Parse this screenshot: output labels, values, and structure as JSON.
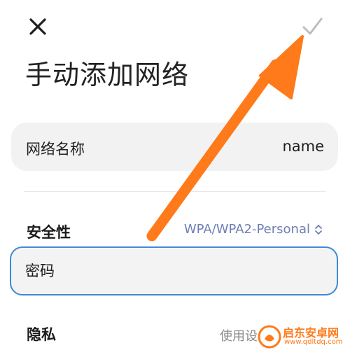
{
  "header": {
    "close_icon": "close-icon",
    "confirm_icon": "checkmark-icon"
  },
  "title": "手动添加网络",
  "network_name": {
    "label": "网络名称",
    "value": "name"
  },
  "security": {
    "label": "安全性",
    "value": "WPA/WPA2-Personal",
    "icon": "chevron-up-down-icon"
  },
  "password": {
    "placeholder": "密码",
    "value": ""
  },
  "privacy": {
    "label": "隐私",
    "value": "使用设"
  },
  "annotation": {
    "arrow_color": "#ff7a1a",
    "arrow_target": "confirm-button"
  },
  "watermark": {
    "title": "启东安卓网",
    "url": "www.qdltdq.com"
  },
  "colors": {
    "accent_border": "#3d8ad8",
    "card_bg": "#f2f2f2",
    "security_value": "#6f7fb5",
    "confirm_icon": "#bdbdbd"
  }
}
